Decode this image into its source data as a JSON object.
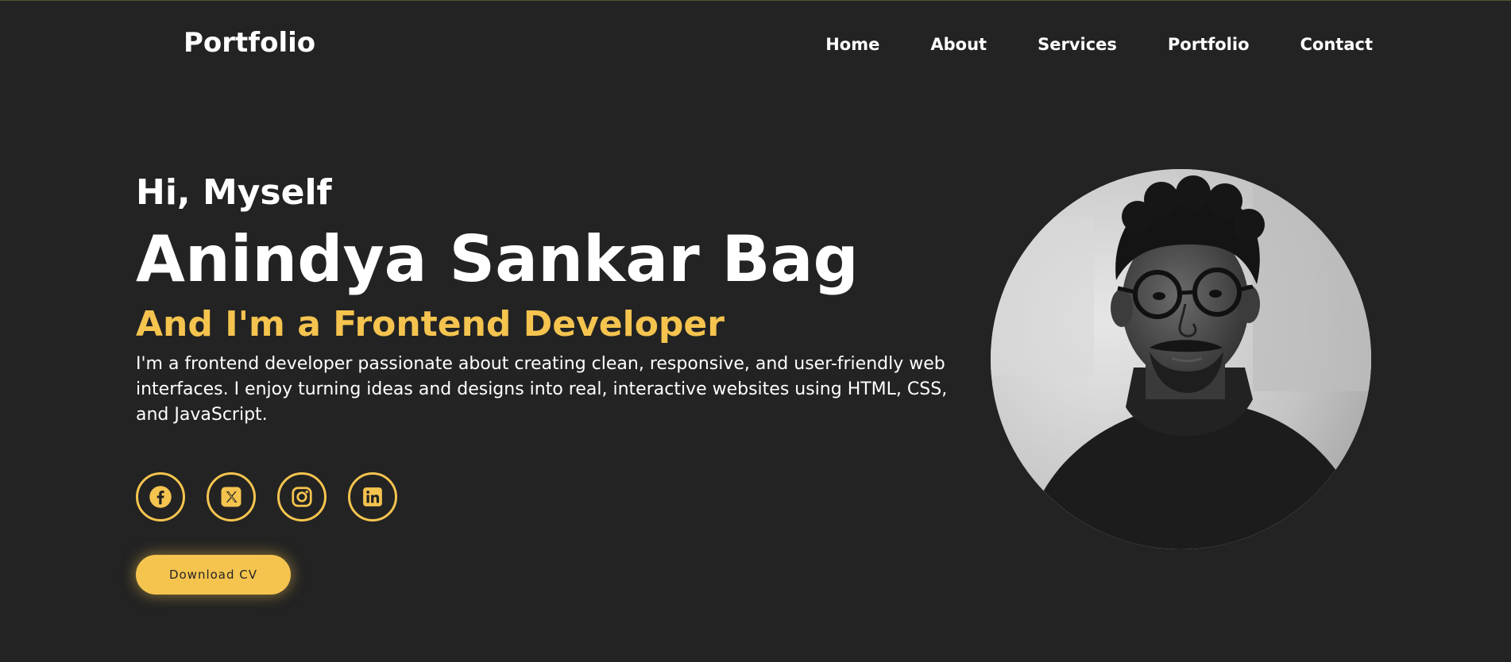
{
  "header": {
    "logo": "Portfolio",
    "nav": [
      "Home",
      "About",
      "Services",
      "Portfolio",
      "Contact"
    ]
  },
  "hero": {
    "greeting": "Hi, Myself",
    "name": "Anindya Sankar Bag",
    "role": "And I'm a Frontend Developer",
    "bio": "I'm a frontend developer passionate about creating clean, responsive, and user-friendly web interfaces. I enjoy turning ideas and designs into real, interactive websites using HTML, CSS, and JavaScript.",
    "socials": [
      {
        "icon": "facebook-icon"
      },
      {
        "icon": "x-icon"
      },
      {
        "icon": "instagram-icon"
      },
      {
        "icon": "linkedin-icon"
      }
    ],
    "cv_button": "Download CV"
  },
  "colors": {
    "background": "#232323",
    "accent": "#f5c44f",
    "text": "#ffffff"
  }
}
